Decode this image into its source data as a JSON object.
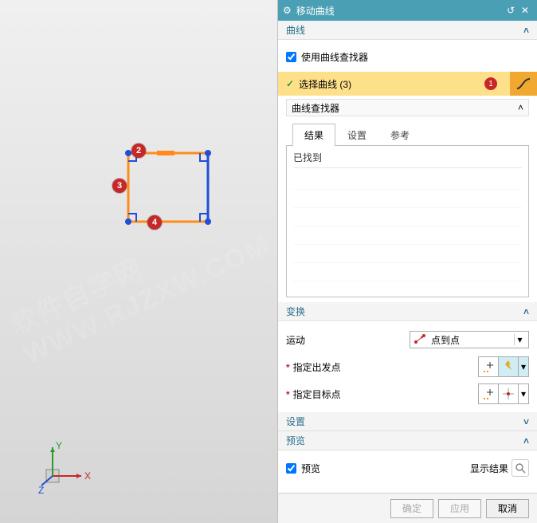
{
  "titlebar": {
    "title": "移动曲线"
  },
  "sections": {
    "curve": {
      "title": "曲线",
      "use_finder_label": "使用曲线查找器",
      "use_finder_checked": true,
      "select_curve_label": "选择曲线 (3)",
      "marker": "1",
      "finder": {
        "title": "曲线查找器",
        "tabs": {
          "results": "结果",
          "settings": "设置",
          "reference": "参考"
        },
        "found_label": "已找到"
      }
    },
    "transform": {
      "title": "变换",
      "motion_label": "运动",
      "motion_value": "点到点",
      "from_label": "指定出发点",
      "to_label": "指定目标点"
    },
    "settings": {
      "title": "设置"
    },
    "preview": {
      "title": "预览",
      "checkbox_label": "预览",
      "checked": true,
      "show_result": "显示结果"
    }
  },
  "footer": {
    "ok": "确定",
    "apply": "应用",
    "cancel": "取消"
  },
  "viewport": {
    "markers": {
      "m2": "2",
      "m3": "3",
      "m4": "4"
    },
    "axes": {
      "x": "X",
      "y": "Y",
      "z": "Z"
    },
    "watermark": "软件自学网 WWW.RJZXW.COM"
  }
}
